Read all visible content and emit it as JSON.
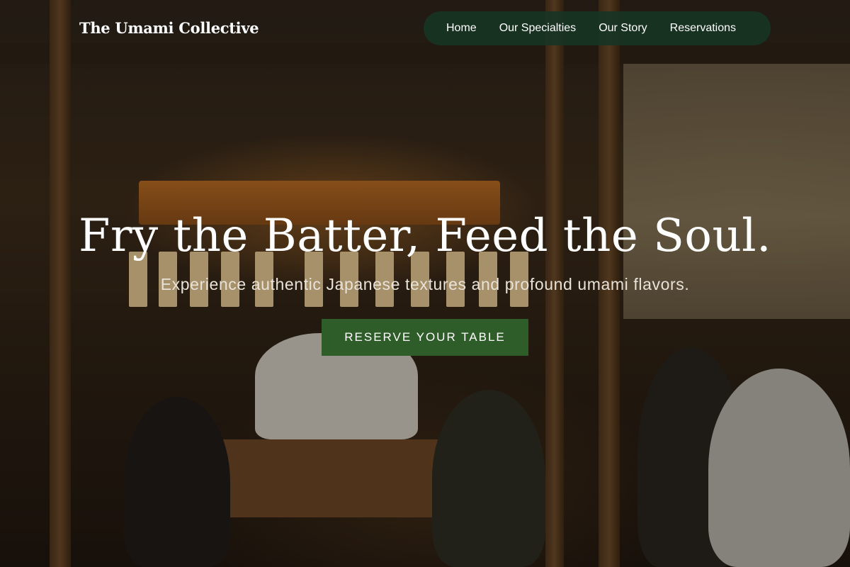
{
  "brand": {
    "name": "The Umami Collective"
  },
  "nav": {
    "items": [
      {
        "label": "Home"
      },
      {
        "label": "Our Specialties"
      },
      {
        "label": "Our Story"
      },
      {
        "label": "Reservations"
      }
    ]
  },
  "hero": {
    "title": "Fry the Batter, Feed the Soul.",
    "subtitle": "Experience authentic Japanese textures and profound umami flavors.",
    "cta_label": "RESERVE YOUR TABLE"
  },
  "colors": {
    "nav_background": "#183424",
    "cta_background": "#2f5d2a",
    "text": "#ffffff"
  }
}
